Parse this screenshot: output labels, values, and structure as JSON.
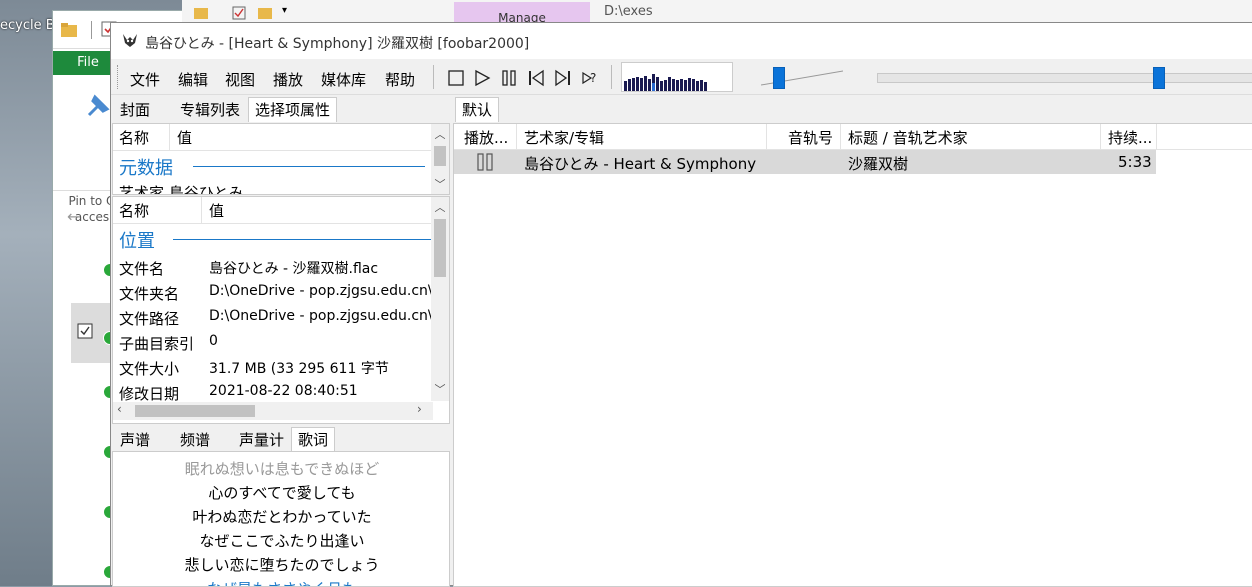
{
  "desktop": {
    "recycle_label": "ecycle B"
  },
  "explorer": {
    "file_tab": "File",
    "pin_text_1": "Pin to Q",
    "pin_text_2": "acces",
    "manage_tab": "Manage",
    "path": "D:\\exes"
  },
  "window": {
    "title": "島谷ひとみ - [Heart & Symphony] 沙羅双樹  [foobar2000]"
  },
  "menu": {
    "file": "文件",
    "edit": "编辑",
    "view": "视图",
    "playback": "播放",
    "library": "媒体库",
    "help": "帮助"
  },
  "panels": {
    "top_tabs": [
      "封面",
      "专辑列表",
      "选择项属性"
    ],
    "props_header": {
      "name": "名称",
      "value": "值"
    },
    "metadata_title": "元数据",
    "metadata_partial": "艺术家  島谷ひとみ",
    "location_title": "位置",
    "location_rows": [
      {
        "name": "文件名",
        "value": "島谷ひとみ - 沙羅双樹.flac"
      },
      {
        "name": "文件夹名",
        "value": "D:\\OneDrive - pop.zjgsu.edu.cn\\Ec"
      },
      {
        "name": "文件路径",
        "value": "D:\\OneDrive - pop.zjgsu.edu.cn\\Ec"
      },
      {
        "name": "子曲目索引",
        "value": "0"
      },
      {
        "name": "文件大小",
        "value": "31.7 MB (33 295 611 字节"
      },
      {
        "name": "修改日期",
        "value": "2021-08-22 08:40:51"
      }
    ],
    "bottom_tabs": [
      "声谱",
      "频谱",
      "声量计",
      "歌词"
    ]
  },
  "lyrics": [
    {
      "text": "眠れぬ想いは息もできぬほど",
      "color": "#9a9a9a"
    },
    {
      "text": "心のすべてで愛しても",
      "color": "#000000"
    },
    {
      "text": "叶わぬ恋だとわかっていた",
      "color": "#000000"
    },
    {
      "text": "なぜここでふたり出逢い",
      "color": "#000000"
    },
    {
      "text": "悲しい恋に堕ちたのでしょう",
      "color": "#000000"
    },
    {
      "text": "なぜ星もささやく月も",
      "color": "#1a78c8"
    }
  ],
  "playlist": {
    "tab": "默认",
    "columns": {
      "playing": "播放...",
      "artist_album": "艺术家/专辑",
      "track_no": "音轨号",
      "title_artist": "标题 / 音轨艺术家",
      "duration": "持续..."
    },
    "row": {
      "artist_album": "島谷ひとみ - Heart & Symphony",
      "track_no": "",
      "title": "沙羅双樹",
      "duration": "5:33"
    }
  },
  "colors": {
    "accent": "#1a78c8",
    "seek": "#0a73d9",
    "explorer_green": "#1e8a3c"
  }
}
